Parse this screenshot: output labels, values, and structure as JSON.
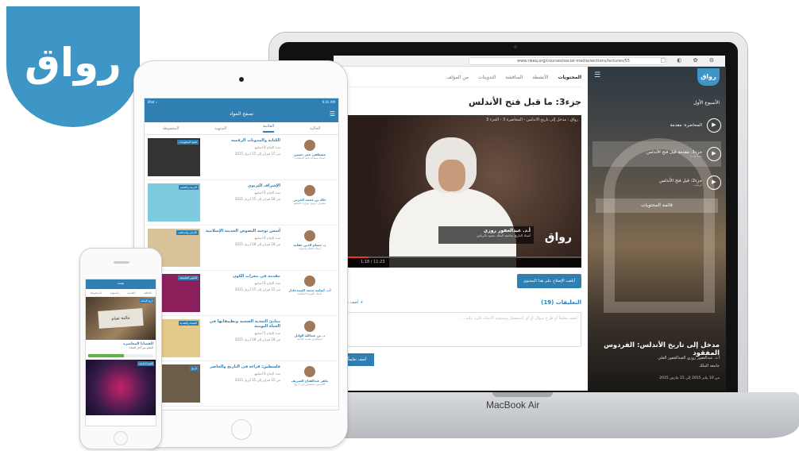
{
  "logo": {
    "text": "رواق"
  },
  "laptop": {
    "brand": "MacBook Air",
    "browser": {
      "url": "www.rwaq.org/courses/social-media/sections/lectures/55"
    },
    "main": {
      "tabs": [
        "المحتويات",
        "الأنشطة",
        "المناقشة",
        "التدوينات",
        "من المؤلف"
      ],
      "section_title": "جزء3: ما قبل فتح الأندلس",
      "video": {
        "top_title": "رواق : مدخل إلى تاريخ الأندلس - المحاضرة 3 - الجزء 3",
        "speaker_name": "أ.د. عبدالغفور روزي",
        "speaker_role": "أستاذ التاريخ بجامعة الملك سعود بالرياض",
        "watermark": "رواق",
        "time": "1:18 / 11:23",
        "progress_pct": 12
      },
      "report_button": "أبلغت الإصلاح على هذا المحتوى",
      "comments_title": "التعليقات (19)",
      "add_comment": "+ أضف تعليق",
      "comment_placeholder": "أضف تعليقاً أو طرح سؤال أو أي استفسار وسيقوم الأستاذ بالرد عليه ...",
      "submit_button": "أضف تعليقاً"
    },
    "side": {
      "logo": "رواق",
      "week": "الأسبوع الأول",
      "lessons": [
        {
          "title": "المحاضرة: مقدمة",
          "sub": ""
        },
        {
          "title": "جزء1: مقدمة قبل فتح الأندلس",
          "sub": "مشاهدة"
        },
        {
          "title": "جزء2: قبل فتح الأندلس",
          "sub": "ترتيب"
        }
      ],
      "toc_label": "قائمة المحتويات",
      "course_title": "مدخل إلى تاريخ الأندلس: الفردوس المفقود",
      "instructor": "أ.د. عبدالغفور روزي العبدالغفور العلي",
      "university": "جامعة الملك",
      "dates": "من 10 يناير 2015 إلى 15 مارس 2015"
    }
  },
  "tablet": {
    "status_left": "iPad ✓",
    "status_right": "9:41 AM",
    "header_title": "تصفح المواد",
    "tabs": [
      "الحالية",
      "القادمة",
      "المنتهية",
      "المحفوظة"
    ],
    "active_tab": 1,
    "courses": [
      {
        "tag": "تقنية المعلومات",
        "title": "الكتابة والمدونات الرقمية",
        "meta": "مدة الإنتاج 8 أسابيع",
        "dates": "من 15 فبراير إلى 15 أبريل 2015",
        "instructor": "مصطفى عمر حسين",
        "role": "أستاذ مساعد علم المكتبات",
        "thumb": "#333"
      },
      {
        "tag": "التربية والتعليم",
        "title": "الإشراف التربوي",
        "meta": "مدة الإنتاج 6 أسابيع",
        "dates": "من 18 فبراير إلى 15 أبريل 2015",
        "instructor": "خالد بن محمد الحربي",
        "role": "مشرف تربوي بوزارة التعليم",
        "thumb": "#7ecbe0"
      },
      {
        "tag": "الأديان والمذاهب",
        "title": "أسس توجيه النصوص الحديثة الإسلامية",
        "meta": "مدة الإنتاج 8 أسابيع",
        "dates": "من 18 فبراير إلى 18 أبريل 2015",
        "instructor": "د. حسام الدين عفانة",
        "role": "أستاذ الفقه وأصوله",
        "thumb": "#d8c39a"
      },
      {
        "tag": "العلوم الطبيعية",
        "title": "مقدمة في مجرات الكون",
        "meta": "مدة الإنتاج 6 أسابيع",
        "dates": "من 15 فبراير إلى 15 أبريل 2015",
        "instructor": "أ.د. أسامة محمد السيدعادل",
        "role": "أستاذ الفيزياء الفلكية",
        "thumb": "#8a1f5c"
      },
      {
        "tag": "الصحة والتغذية",
        "title": "مبادئ التغذية الصحية وتطبيقاتها في الحياة اليومية",
        "meta": "مدة الإنتاج 5 أسابيع",
        "dates": "من 18 فبراير إلى 18 أبريل 2015",
        "instructor": "د. بن عبدالله الوابل",
        "role": "استشاري تغذية علاجية",
        "thumb": "#e3c98a"
      },
      {
        "tag": "تاريخ",
        "title": "فلسطين: قراءة في التاريخ والحاضر",
        "meta": "مدة الإنتاج 6 أسابيع",
        "dates": "من 15 فبراير إلى 15 أبريل 2015",
        "instructor": "ماهر عبدالفتاح الشريف",
        "role": "أكاديمي متخصص في تاريخ",
        "thumb": "#6d5e4a"
      }
    ]
  },
  "phone": {
    "header_title": "بحث",
    "tabs": [
      "الحالية",
      "القادمة",
      "المنتهية",
      "المحفوظة"
    ],
    "card1": {
      "tag": "تاريخ الإسلام",
      "sign": "مكتبة تشام",
      "title": "القضايا المعاصرة",
      "sub": "التعلم من أجل الحياة",
      "progress_pct": 55
    },
    "card2": {
      "tag": "العلوم الطبيعية"
    }
  }
}
